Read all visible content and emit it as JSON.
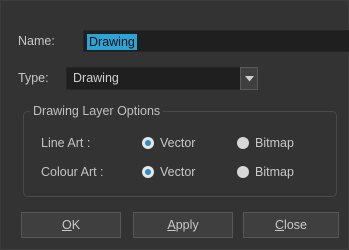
{
  "form": {
    "name_label": "Name:",
    "name_value": "Drawing",
    "type_label": "Type:",
    "type_value": "Drawing"
  },
  "options": {
    "title": "Drawing Layer Options",
    "line_art_label": "Line Art :",
    "colour_art_label": "Colour Art :",
    "vector_label": "Vector",
    "bitmap_label": "Bitmap",
    "line_art_selected": "Vector",
    "colour_art_selected": "Vector"
  },
  "buttons": {
    "ok_mnemonic": "O",
    "ok_rest": "K",
    "apply_mnemonic": "A",
    "apply_rest": "pply",
    "close_mnemonic": "C",
    "close_rest": "lose"
  },
  "colors": {
    "background": "#333333",
    "field": "#1f1f1f",
    "selection": "#2aa5d6",
    "radio_accent": "#2a8fc7"
  },
  "icons": {
    "dropdown": "chevron-down-icon"
  }
}
